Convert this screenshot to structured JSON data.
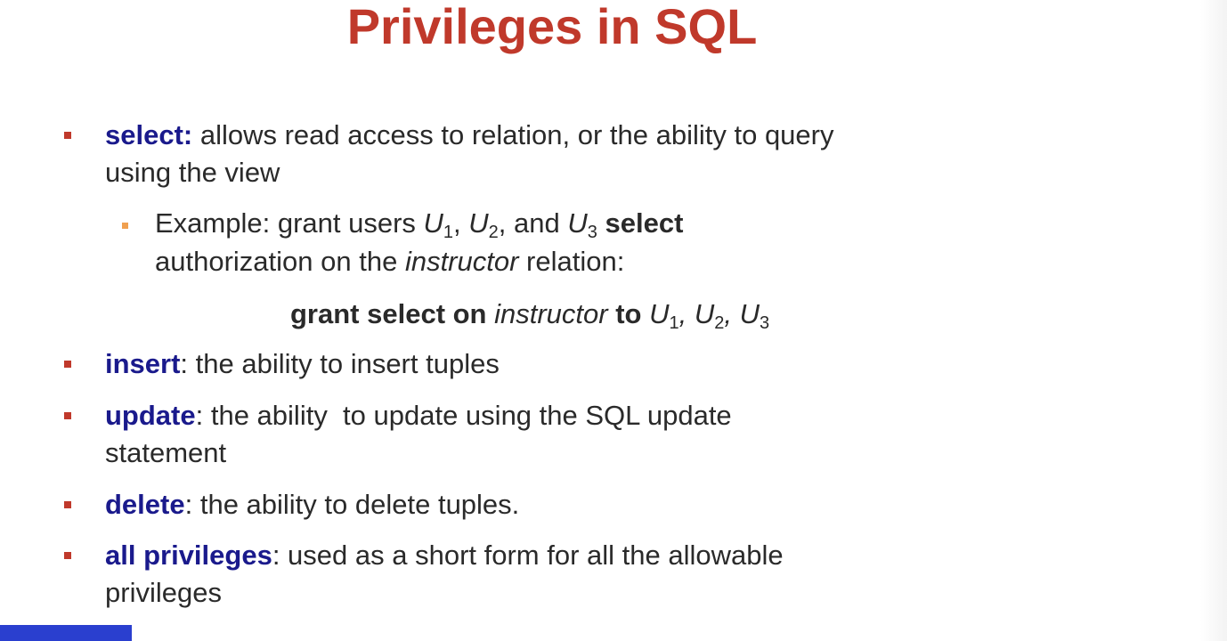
{
  "title": "Privileges in SQL",
  "colors": {
    "title": "#c0392b",
    "keyword": "#1a1a8c",
    "bullet": "#c0392b",
    "sub_bullet": "#f0a050",
    "bottom_bar": "#2a3fcf"
  },
  "items": {
    "select": {
      "keyword": "select:",
      "line1": " allows read access to relation, or the ability to query",
      "line2": "using the view"
    },
    "example": {
      "prefix": "Example: grant users ",
      "u1": "U",
      "s1": "1",
      "sep1": ", ",
      "u2": "U",
      "s2": "2",
      "sep2": ", and ",
      "u3": "U",
      "s3": "3",
      "select_word": " select",
      "line2_a": "authorization on the ",
      "line2_it": "instructor",
      "line2_b": " relation:"
    },
    "grant": {
      "a": "grant select on ",
      "it": "instructor",
      "b": " to ",
      "u1": "U",
      "s1": "1",
      "sep1": ", ",
      "u2": "U",
      "s2": "2",
      "sep2": ", ",
      "u3": "U",
      "s3": "3"
    },
    "insert": {
      "keyword": "insert",
      "text": ": the ability to insert tuples"
    },
    "update": {
      "keyword": "update",
      "line1": ": the ability  to update using the SQL update",
      "line2": "statement"
    },
    "delete": {
      "keyword": "delete",
      "text": ": the ability to delete tuples."
    },
    "all": {
      "keyword": "all privileges",
      "line1": ": used as a short form for all the allowable",
      "line2": "privileges"
    }
  }
}
